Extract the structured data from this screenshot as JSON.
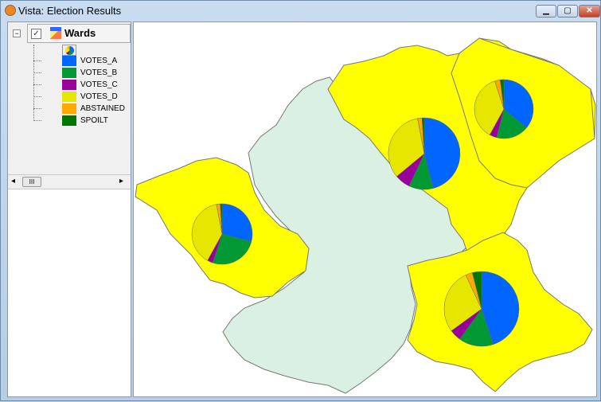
{
  "window": {
    "title": "Vista: Election Results",
    "minimize": "▁",
    "maximize": "▢",
    "close": "✕"
  },
  "layer": {
    "name": "Wards",
    "checked": true,
    "check": "✓",
    "collapse": "−"
  },
  "legend": [
    {
      "label": "VOTES_A",
      "color": "#0066ff"
    },
    {
      "label": "VOTES_B",
      "color": "#009933"
    },
    {
      "label": "VOTES_C",
      "color": "#990099"
    },
    {
      "label": "VOTES_D",
      "color": "#e6e600"
    },
    {
      "label": "ABSTAINED",
      "color": "#ffaa00"
    },
    {
      "label": "SPOILT",
      "color": "#007700"
    }
  ],
  "scroll": {
    "left": "◂",
    "right": "▸",
    "thumb": "III"
  },
  "colors": {
    "highlight": "#ffff00",
    "base": "#d9f0e3",
    "border": "#777777"
  },
  "wards": [
    {
      "fill": "highlight",
      "pie": [
        0.29,
        0.26,
        0.03,
        0.39,
        0.02,
        0.01
      ]
    },
    {
      "fill": "highlight",
      "pie": [
        0.46,
        0.11,
        0.07,
        0.33,
        0.02,
        0.01
      ]
    },
    {
      "fill": "highlight",
      "pie": [
        0.36,
        0.18,
        0.04,
        0.37,
        0.03,
        0.02
      ]
    },
    {
      "fill": "highlight",
      "pie": [
        0.45,
        0.15,
        0.05,
        0.28,
        0.03,
        0.04
      ]
    },
    {
      "fill": "base"
    }
  ]
}
